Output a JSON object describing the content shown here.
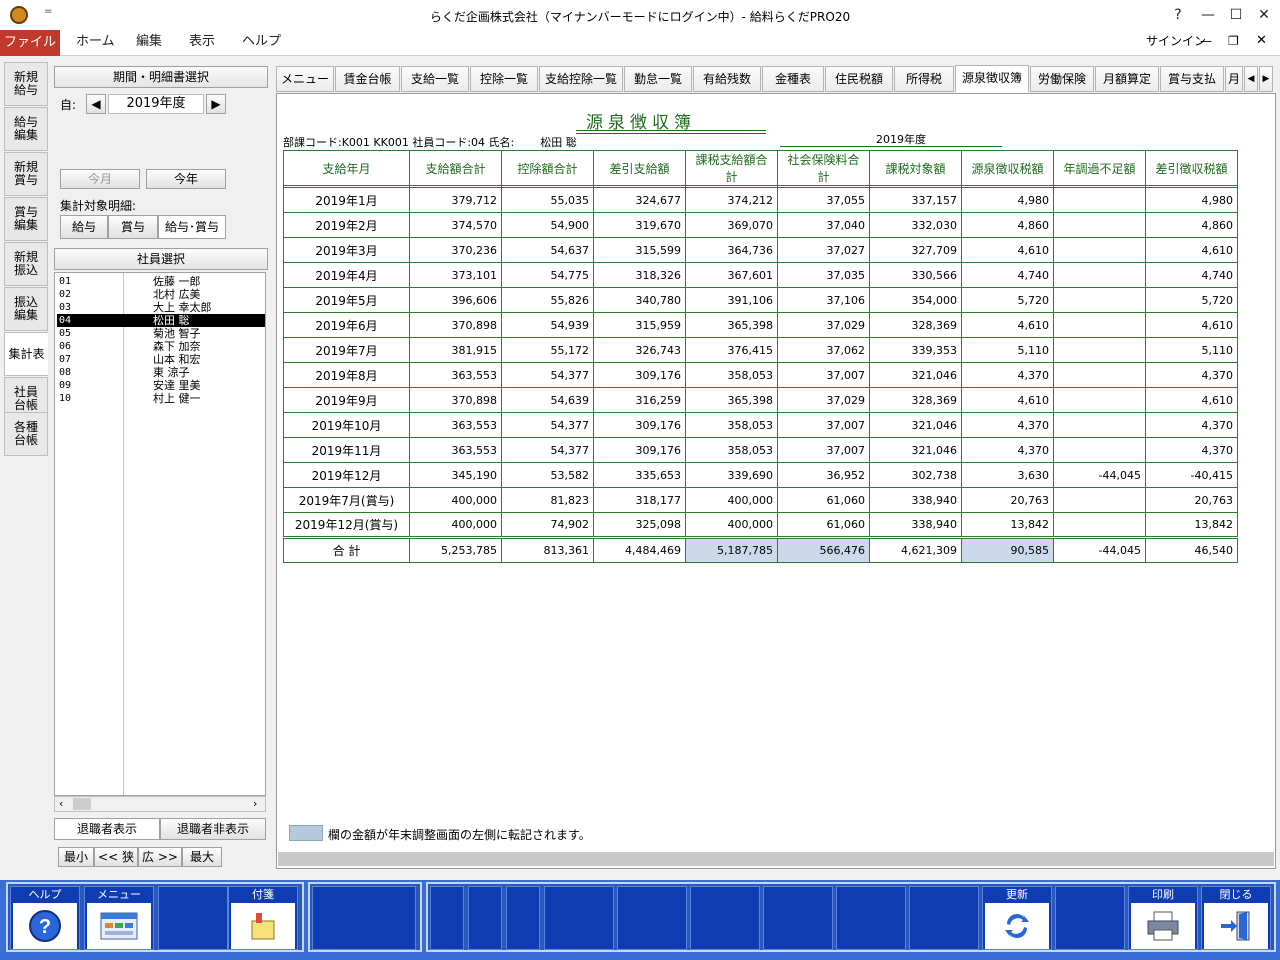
{
  "window": {
    "title": "らくだ企画株式会社（マイナンバーモードにログイン中）- 給料らくだPRO20",
    "qat": "=",
    "help_btn": "?",
    "min": "—",
    "max": "☐",
    "close": "✕"
  },
  "ribbon": {
    "file": "ファイル",
    "tabs": [
      "ホーム",
      "編集",
      "表示",
      "ヘルプ"
    ],
    "signin": "サインイン"
  },
  "lefttabs": [
    "新規\n給与",
    "給与\n編集",
    "新規\n賞与",
    "賞与\n編集",
    "新規\n振込",
    "振込\n編集",
    "集計表",
    "社員\n台帳",
    "各種\n台帳"
  ],
  "period": {
    "header": "期間・明細書選択",
    "from_label": "自:",
    "year": "2019年度",
    "this_month": "今月",
    "this_year": "今年",
    "target_label": "集計対象明細:",
    "targets": [
      "給与",
      "賞与",
      "給与･賞与"
    ]
  },
  "employees": {
    "header": "社員選択",
    "rows": [
      {
        "code": "01",
        "name": "佐藤 一郎"
      },
      {
        "code": "02",
        "name": "北村 広美"
      },
      {
        "code": "03",
        "name": "大上 幸太郎"
      },
      {
        "code": "04",
        "name": "松田 聡"
      },
      {
        "code": "05",
        "name": "菊池 智子"
      },
      {
        "code": "06",
        "name": "森下 加奈"
      },
      {
        "code": "07",
        "name": "山本 和宏"
      },
      {
        "code": "08",
        "name": "東 涼子"
      },
      {
        "code": "09",
        "name": "安達 里美"
      },
      {
        "code": "10",
        "name": "村上 健一"
      }
    ],
    "show_retired": "退職者表示",
    "hide_retired": "退職者非表示",
    "sizes": [
      "最小",
      "<< 狭",
      "広 >>",
      "最大"
    ]
  },
  "tabs": [
    "メニュー",
    "賃金台帳",
    "支給一覧",
    "控除一覧",
    "支給控除一覧",
    "勤怠一覧",
    "有給残数",
    "金種表",
    "住民税額",
    "所得税",
    "源泉徴収簿",
    "労働保険",
    "月額算定",
    "賞与支払",
    "月"
  ],
  "report": {
    "title": "源泉徴収簿",
    "info": "部課コード:K001 KK001  社員コード:04  氏名:",
    "emp_name": "松田 聡",
    "year": "2019年度",
    "columns": [
      "支給年月",
      "支給額合計",
      "控除額合計",
      "差引支給額",
      "課税支給額合計",
      "社会保険料合計",
      "課税対象額",
      "源泉徴収税額",
      "年調過不足額",
      "差引徴収税額"
    ],
    "rows": [
      [
        "2019年1月",
        "379,712",
        "55,035",
        "324,677",
        "374,212",
        "37,055",
        "337,157",
        "4,980",
        "",
        "4,980"
      ],
      [
        "2019年2月",
        "374,570",
        "54,900",
        "319,670",
        "369,070",
        "37,040",
        "332,030",
        "4,860",
        "",
        "4,860"
      ],
      [
        "2019年3月",
        "370,236",
        "54,637",
        "315,599",
        "364,736",
        "37,027",
        "327,709",
        "4,610",
        "",
        "4,610"
      ],
      [
        "2019年4月",
        "373,101",
        "54,775",
        "318,326",
        "367,601",
        "37,035",
        "330,566",
        "4,740",
        "",
        "4,740"
      ],
      [
        "2019年5月",
        "396,606",
        "55,826",
        "340,780",
        "391,106",
        "37,106",
        "354,000",
        "5,720",
        "",
        "5,720"
      ],
      [
        "2019年6月",
        "370,898",
        "54,939",
        "315,959",
        "365,398",
        "37,029",
        "328,369",
        "4,610",
        "",
        "4,610"
      ],
      [
        "2019年7月",
        "381,915",
        "55,172",
        "326,743",
        "376,415",
        "37,062",
        "339,353",
        "5,110",
        "",
        "5,110"
      ],
      [
        "2019年8月",
        "363,553",
        "54,377",
        "309,176",
        "358,053",
        "37,007",
        "321,046",
        "4,370",
        "",
        "4,370"
      ],
      [
        "2019年9月",
        "370,898",
        "54,639",
        "316,259",
        "365,398",
        "37,029",
        "328,369",
        "4,610",
        "",
        "4,610"
      ],
      [
        "2019年10月",
        "363,553",
        "54,377",
        "309,176",
        "358,053",
        "37,007",
        "321,046",
        "4,370",
        "",
        "4,370"
      ],
      [
        "2019年11月",
        "363,553",
        "54,377",
        "309,176",
        "358,053",
        "37,007",
        "321,046",
        "4,370",
        "",
        "4,370"
      ],
      [
        "2019年12月",
        "345,190",
        "53,582",
        "335,653",
        "339,690",
        "36,952",
        "302,738",
        "3,630",
        "-44,045",
        "-40,415"
      ],
      [
        "2019年7月(賞与)",
        "400,000",
        "81,823",
        "318,177",
        "400,000",
        "61,060",
        "338,940",
        "20,763",
        "",
        "20,763"
      ],
      [
        "2019年12月(賞与)",
        "400,000",
        "74,902",
        "325,098",
        "400,000",
        "61,060",
        "338,940",
        "13,842",
        "",
        "13,842"
      ]
    ],
    "total": [
      "合 計",
      "5,253,785",
      "813,361",
      "4,484,469",
      "5,187,785",
      "566,476",
      "4,621,309",
      "90,585",
      "-44,045",
      "46,540"
    ],
    "legend": "欄の金額が年末調整画面の左側に転記されます。",
    "highlight_color": "#ccd9ea"
  },
  "fkeys": {
    "help": "ヘルプ",
    "menu": "メニュー",
    "tag": "付箋",
    "refresh": "更新",
    "print": "印刷",
    "close": "閉じる"
  }
}
